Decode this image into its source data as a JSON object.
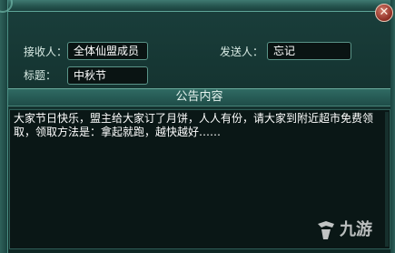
{
  "form": {
    "recipient_label": "接收人：",
    "recipient_value": "全体仙盟成员",
    "sender_label": "发送人：",
    "sender_value": "忘记",
    "subject_label": "标题：",
    "subject_value": "中秋节"
  },
  "content": {
    "header": "公告内容",
    "body": "大家节日快乐，盟主给大家订了月饼，人人有份，请大家到附近超市免费领取，领取方法是：拿起就跑，越快越好……"
  },
  "window": {
    "close_glyph": "✕"
  },
  "watermark": {
    "text": "九游"
  },
  "colors": {
    "panel": "#14322f",
    "border": "#5a9488",
    "close_button": "#8d2c22",
    "text": "#ffffff"
  }
}
